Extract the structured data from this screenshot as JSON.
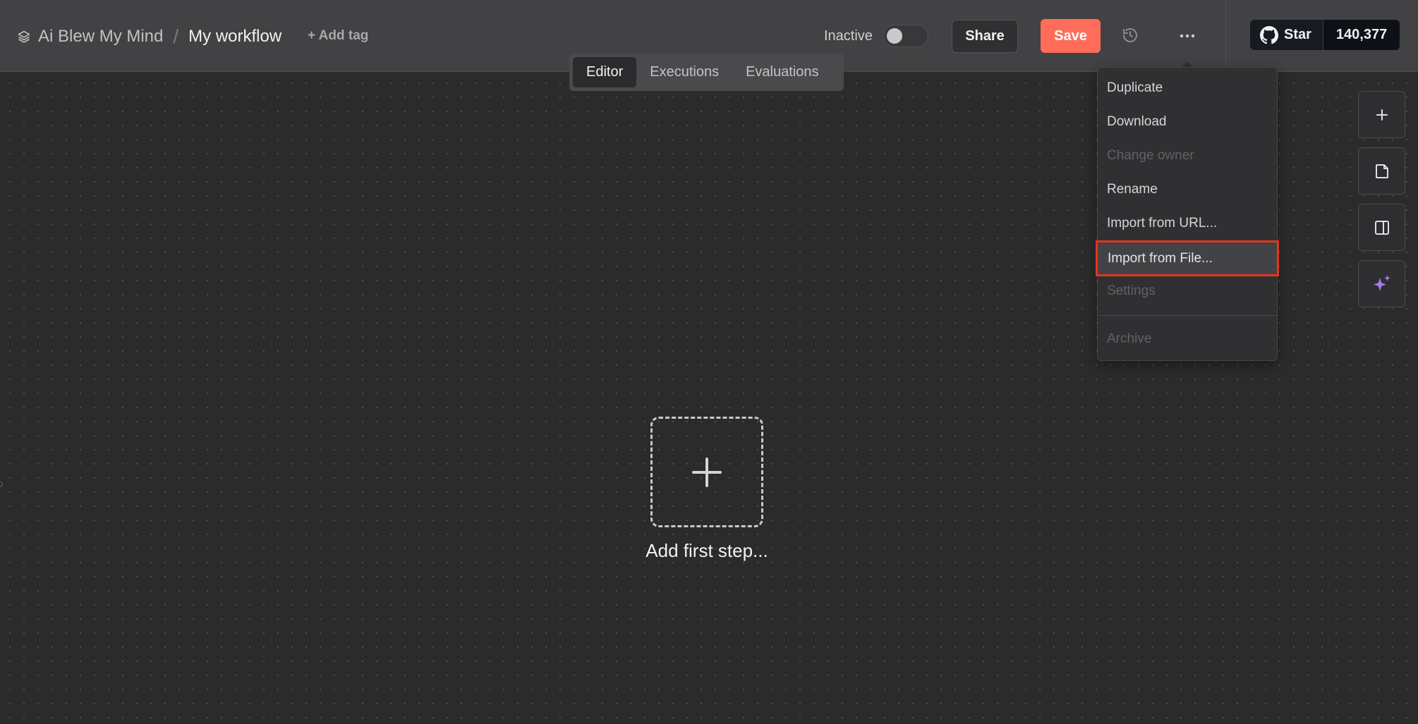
{
  "breadcrumb": {
    "project": "Ai Blew My Mind",
    "separator": "/",
    "workflow_name": "My workflow"
  },
  "header": {
    "add_tag_label": "+ Add tag",
    "status_label": "Inactive",
    "active": false,
    "share_label": "Share",
    "save_label": "Save",
    "history_icon": "history-icon",
    "more_icon": "more-horizontal-icon"
  },
  "github": {
    "star_label": "Star",
    "star_count": "140,377"
  },
  "tabs": [
    {
      "label": "Editor",
      "active": true
    },
    {
      "label": "Executions",
      "active": false
    },
    {
      "label": "Evaluations",
      "active": false
    }
  ],
  "canvas": {
    "add_step_label": "Add first step..."
  },
  "side_tools": [
    {
      "icon": "plus-icon"
    },
    {
      "icon": "sticky-note-icon"
    },
    {
      "icon": "panel-right-icon"
    },
    {
      "icon": "sparkles-icon"
    }
  ],
  "menu": {
    "items": [
      {
        "label": "Duplicate",
        "disabled": false
      },
      {
        "label": "Download",
        "disabled": false
      },
      {
        "label": "Change owner",
        "disabled": true
      },
      {
        "label": "Rename",
        "disabled": false
      },
      {
        "label": "Import from URL...",
        "disabled": false
      },
      {
        "label": "Import from File...",
        "disabled": false,
        "highlighted": true
      },
      {
        "label": "Settings",
        "disabled": true
      },
      {
        "label": "Archive",
        "disabled": true
      }
    ]
  },
  "colors": {
    "accent": "#ff6d5a",
    "highlight_border": "#e8331f",
    "ai_sparkle": "#a87cf0"
  }
}
